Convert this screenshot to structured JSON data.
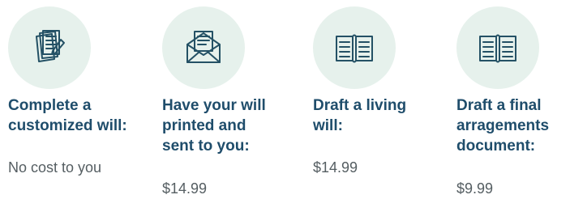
{
  "colors": {
    "icon_background": "#e6f1ec",
    "icon_stroke": "#245165",
    "title_text": "#1f4d6b",
    "price_text": "#555e62"
  },
  "features": [
    {
      "icon": "documents-icon",
      "title": "Complete a\ncustomized will:",
      "price": "No cost to you"
    },
    {
      "icon": "envelope-letter-icon",
      "title": "Have your will\nprinted and\nsent to you:",
      "price": "$14.99"
    },
    {
      "icon": "open-book-icon",
      "title": "Draft a living\nwill:",
      "price": "$14.99"
    },
    {
      "icon": "open-book-icon",
      "title": "Draft a final\narragements\ndocument:",
      "price": "$9.99"
    }
  ]
}
